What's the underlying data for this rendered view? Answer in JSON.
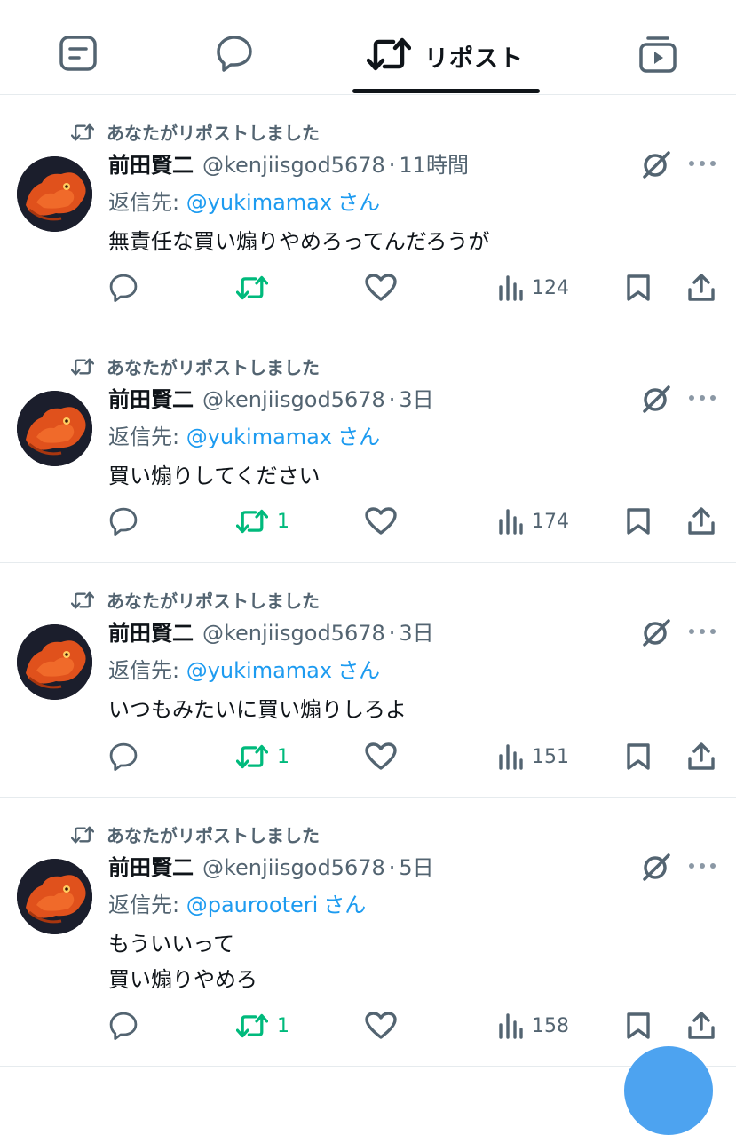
{
  "tabs": [
    {
      "id": "posts",
      "icon": "post-list-icon",
      "label": ""
    },
    {
      "id": "replies",
      "icon": "reply-bubble-icon",
      "label": ""
    },
    {
      "id": "reposts",
      "icon": "repost-icon",
      "label": "リポスト",
      "active": true
    },
    {
      "id": "media",
      "icon": "video-media-icon",
      "label": ""
    }
  ],
  "repost_label": "あなたがリポストしました",
  "reply_prefix": "返信先: ",
  "reply_suffix": "さん",
  "colors": {
    "accent": "#1d9bf0",
    "repost_green": "#00ba7c",
    "muted": "#536471",
    "text": "#0f1419"
  },
  "posts": [
    {
      "display_name": "前田賢二",
      "handle": "@kenjiisgod5678",
      "separator": "·",
      "time": "11時間",
      "reply_to": "@yukimamax",
      "text": "無責任な買い煽りやめろってんだろうが",
      "retweets": "",
      "views": "124"
    },
    {
      "display_name": "前田賢二",
      "handle": "@kenjiisgod5678",
      "separator": "·",
      "time": "3日",
      "reply_to": "@yukimamax",
      "text": "買い煽りしてください",
      "retweets": "1",
      "views": "174"
    },
    {
      "display_name": "前田賢二",
      "handle": "@kenjiisgod5678",
      "separator": "·",
      "time": "3日",
      "reply_to": "@yukimamax",
      "text": "いつもみたいに買い煽りしろよ",
      "retweets": "1",
      "views": "151"
    },
    {
      "display_name": "前田賢二",
      "handle": "@kenjiisgod5678",
      "separator": "·",
      "time": "5日",
      "reply_to": "@paurooteri",
      "text_lines": [
        "もういいって",
        "買い煽りやめろ"
      ],
      "retweets": "1",
      "views": "158"
    }
  ]
}
